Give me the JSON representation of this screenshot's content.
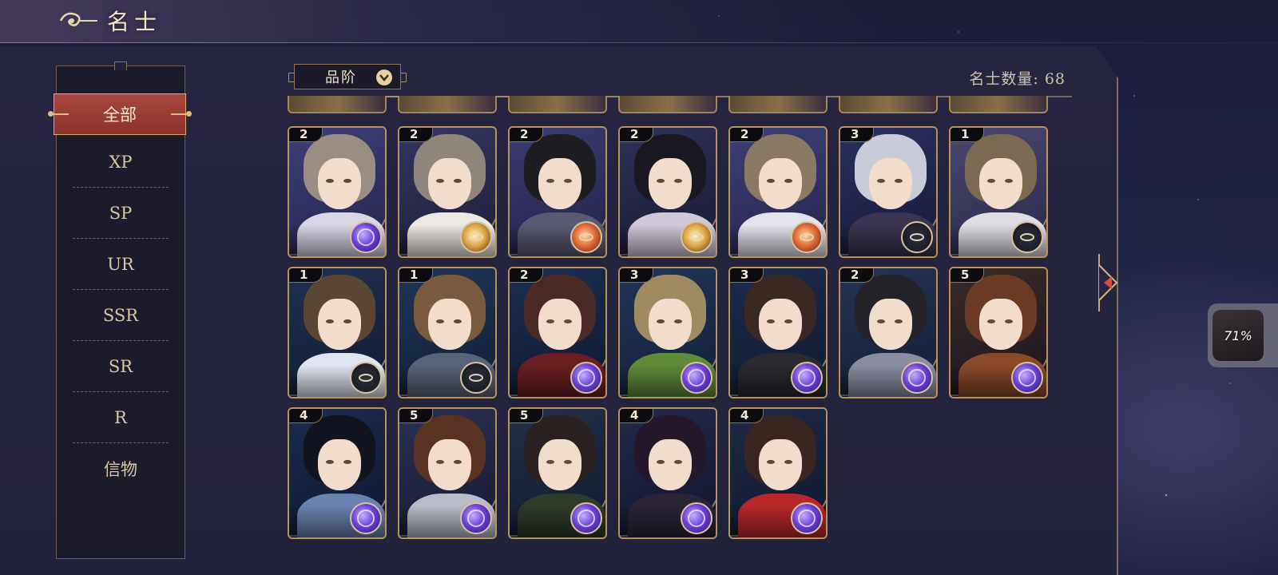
{
  "header": {
    "title": "名士"
  },
  "filter": {
    "label": "品阶"
  },
  "count": {
    "text": "名士数量: 68"
  },
  "sidebar": {
    "items": [
      {
        "label": "全部",
        "active": true
      },
      {
        "label": "XP"
      },
      {
        "label": "SP"
      },
      {
        "label": "UR"
      },
      {
        "label": "SSR"
      },
      {
        "label": "SR"
      },
      {
        "label": "R"
      },
      {
        "label": "信物"
      }
    ]
  },
  "cards": [
    {
      "stars": "2",
      "badge": "orb"
    },
    {
      "stars": "2",
      "badge": "gold"
    },
    {
      "stars": "2",
      "badge": "fire"
    },
    {
      "stars": "2",
      "badge": "gold"
    },
    {
      "stars": "2",
      "badge": "fire"
    },
    {
      "stars": "3",
      "badge": "compass"
    },
    {
      "stars": "1",
      "badge": "compass"
    },
    {
      "stars": "1",
      "badge": "compass"
    },
    {
      "stars": "1",
      "badge": "compass"
    },
    {
      "stars": "2",
      "badge": "orb"
    },
    {
      "stars": "3",
      "badge": "orb"
    },
    {
      "stars": "3",
      "badge": "orb"
    },
    {
      "stars": "2",
      "badge": "orb"
    },
    {
      "stars": "5",
      "badge": "orb"
    },
    {
      "stars": "4",
      "badge": "orb"
    },
    {
      "stars": "5",
      "badge": "orb"
    },
    {
      "stars": "5",
      "badge": "orb"
    },
    {
      "stars": "4",
      "badge": "orb"
    },
    {
      "stars": "4",
      "badge": "orb"
    }
  ],
  "widget": {
    "text": "71%"
  },
  "colors": {
    "accent_gold": "#b8935c",
    "active_tab": "#a8473c",
    "background": "#232548"
  }
}
